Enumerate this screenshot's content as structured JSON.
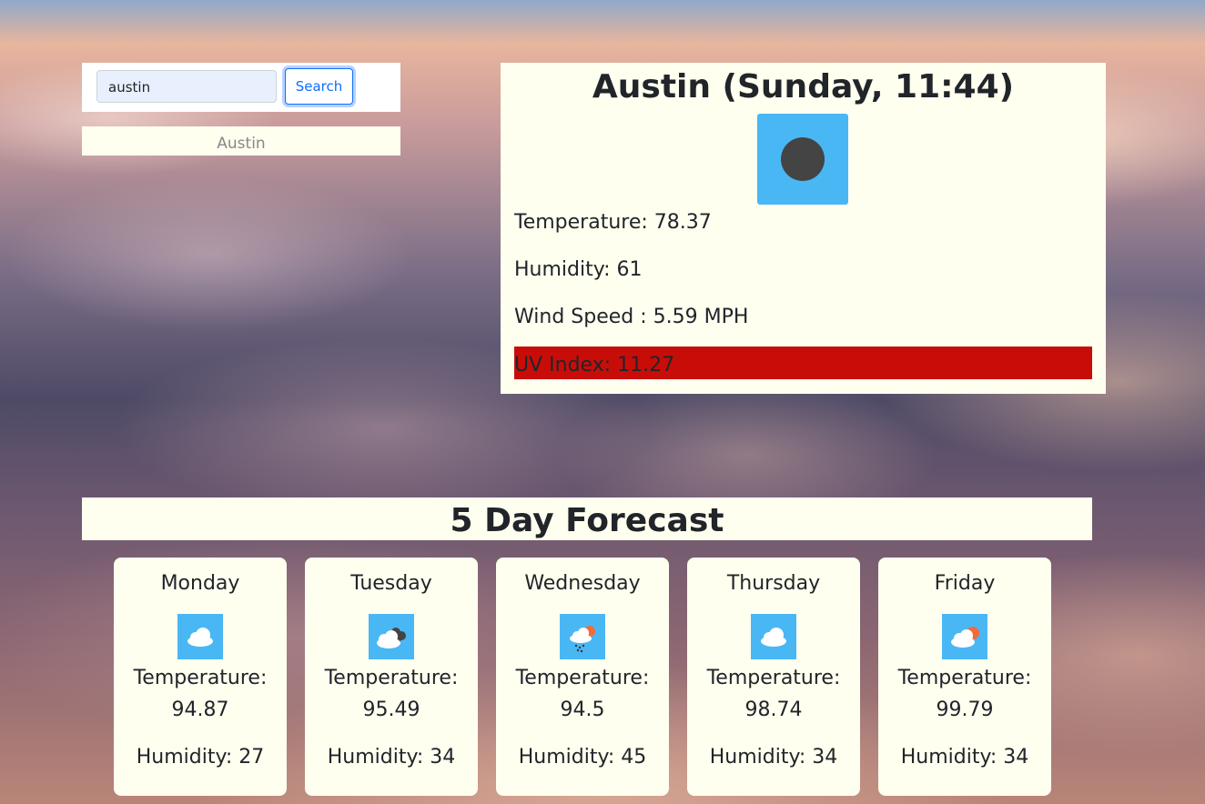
{
  "search": {
    "input_value": "austin",
    "button_label": "Search"
  },
  "history": [
    "Austin"
  ],
  "current": {
    "title": "Austin (Sunday, 11:44)",
    "icon": "dark-circle-icon",
    "temperature_text": "Temperature: 78.37",
    "humidity_text": "Humidity: 61",
    "wind_text": "Wind Speed : 5.59 MPH",
    "uv_text": "UV Index: 11.27",
    "uv_color": "#c80d08"
  },
  "forecast": {
    "header": "5 Day Forecast",
    "days": [
      {
        "day": "Monday",
        "icon": "cloud-icon",
        "temp_label": "Temperature:",
        "temp_value": "94.87",
        "humidity_text": "Humidity: 27"
      },
      {
        "day": "Tuesday",
        "icon": "dark-clouds-icon",
        "temp_label": "Temperature:",
        "temp_value": "95.49",
        "humidity_text": "Humidity: 34"
      },
      {
        "day": "Wednesday",
        "icon": "sun-rain-cloud-icon",
        "temp_label": "Temperature:",
        "temp_value": "94.5",
        "humidity_text": "Humidity: 45"
      },
      {
        "day": "Thursday",
        "icon": "cloud-icon",
        "temp_label": "Temperature:",
        "temp_value": "98.74",
        "humidity_text": "Humidity: 34"
      },
      {
        "day": "Friday",
        "icon": "sun-cloud-icon",
        "temp_label": "Temperature:",
        "temp_value": "99.79",
        "humidity_text": "Humidity: 34"
      }
    ]
  },
  "colors": {
    "card_background": "#fffff0",
    "icon_background": "#4ab7f5",
    "button_accent": "#0d6efd"
  }
}
